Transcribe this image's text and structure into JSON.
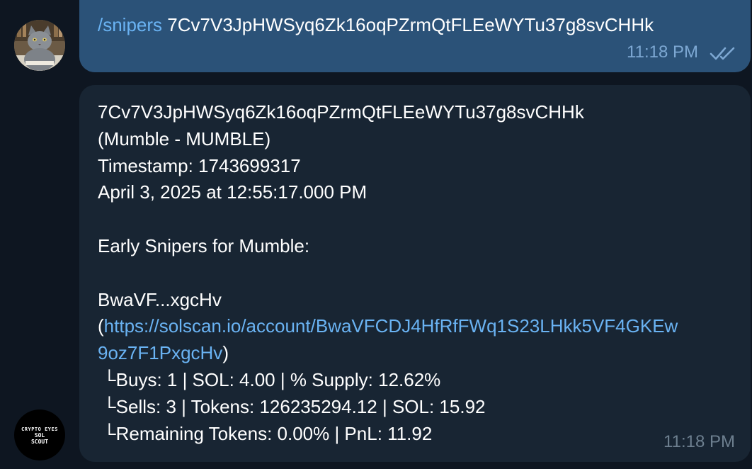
{
  "outgoing": {
    "command": "/snipers",
    "argument": "7Cv7V3JpHWSyq6Zk16oqPZrmQtFLEeWYTu37g8svCHHk",
    "time": "11:18 PM",
    "status_icon": "double-check-icon"
  },
  "incoming": {
    "address": "7Cv7V3JpHWSyq6Zk16oqPZrmQtFLEeWYTu37g8svCHHk",
    "token": "(Mumble - MUMBLE)",
    "timestamp": "Timestamp: 1743699317",
    "date": "April 3, 2025 at 12:55:17.000 PM",
    "heading": "Early Snipers for Mumble:",
    "wallet_short": "BwaVF...xgcHv",
    "link_open": "(",
    "link_part1": "https://solscan.io/account/BwaVFCDJ4HfRfFWq1S23LHkk5VF4GKEw",
    "link_part2": "9oz7F1PxgcHv",
    "link_close": ")",
    "buys": " └Buys: 1 | SOL: 4.00 | % Supply: 12.62%",
    "sells": " └Sells: 3 | Tokens: 126235294.12 | SOL: 15.92",
    "remaining": " └Remaining Tokens: 0.00% | PnL: 11.92",
    "time": "11:18 PM"
  },
  "bot_avatar": {
    "line1": "CRYPTO EYES",
    "line2": "SOL",
    "line3": "SCOUT"
  },
  "colors": {
    "background": "#0e1621",
    "outgoing_bubble": "#2b5278",
    "incoming_bubble": "#182533",
    "link": "#6ab3f3"
  }
}
